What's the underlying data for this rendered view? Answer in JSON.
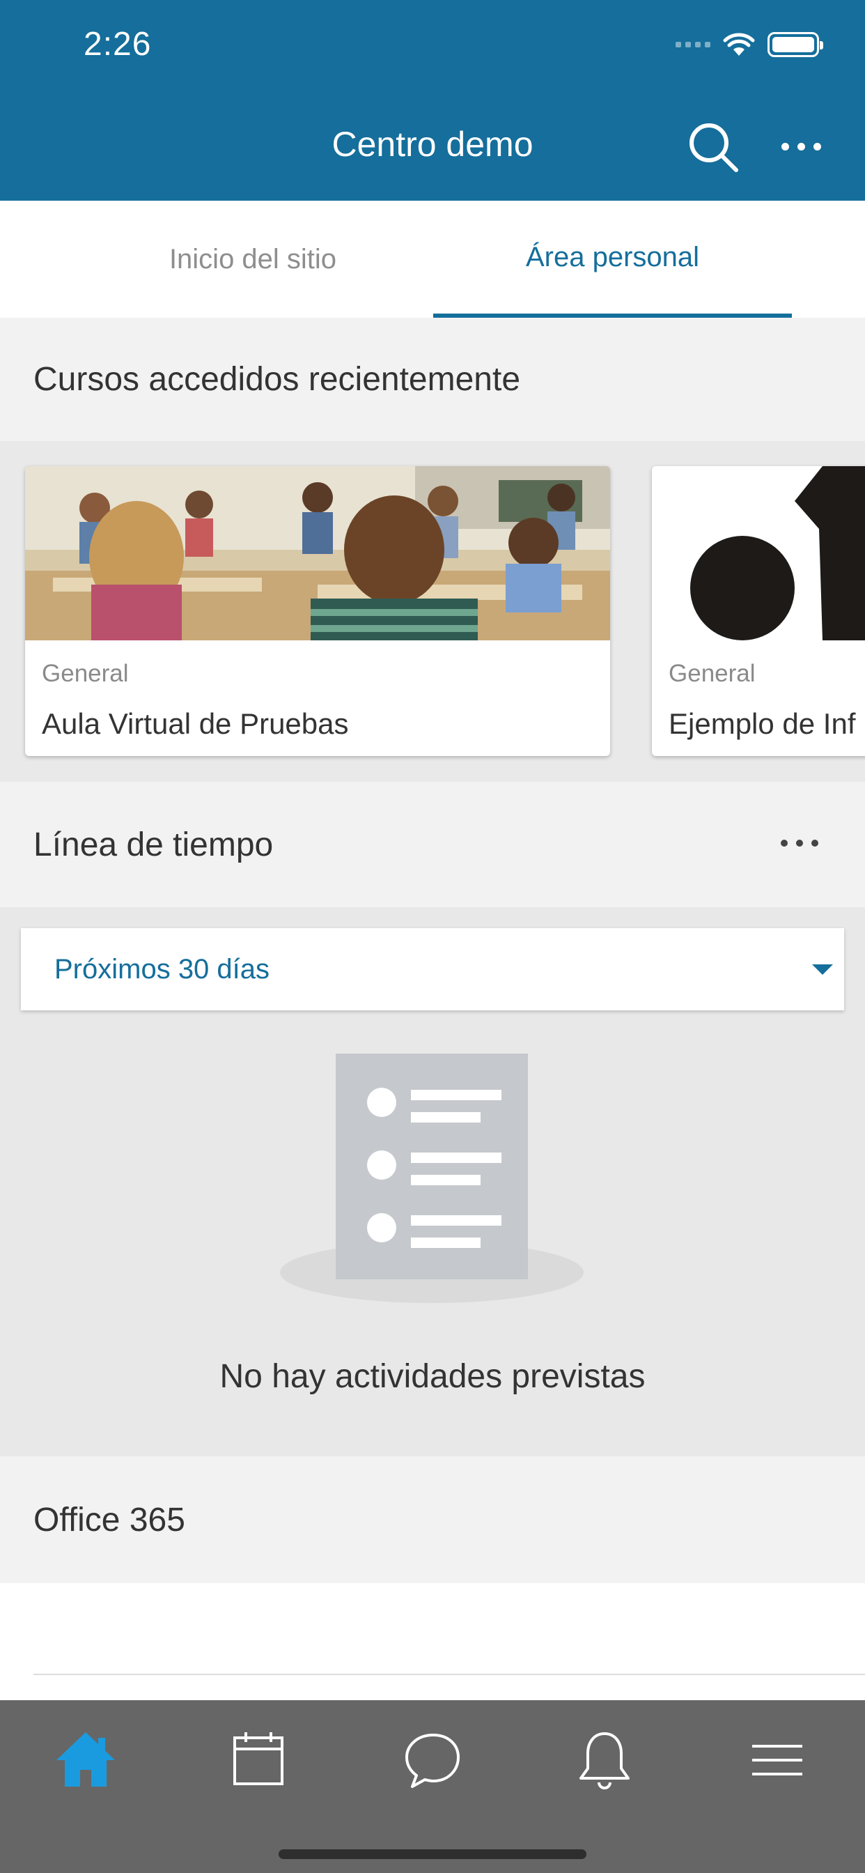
{
  "status_bar": {
    "time": "2:26"
  },
  "header": {
    "title": "Centro demo"
  },
  "tabs": [
    {
      "label": "Inicio del sitio",
      "active": false
    },
    {
      "label": "Área personal",
      "active": true
    }
  ],
  "recent_courses": {
    "title": "Cursos accedidos recientemente",
    "courses": [
      {
        "category": "General",
        "name": "Aula Virtual de Pruebas"
      },
      {
        "category": "General",
        "name": "Ejemplo de Inf"
      }
    ]
  },
  "timeline": {
    "title": "Línea de tiempo",
    "filter": "Próximos 30 días",
    "empty_text": "No hay actividades previstas"
  },
  "office": {
    "title": "Office 365"
  },
  "tabbar": {
    "items": [
      "home-icon",
      "calendar-icon",
      "messages-icon",
      "notifications-icon",
      "menu-icon"
    ],
    "active_color": "#1a9be0"
  },
  "colors": {
    "brand": "#156e9b",
    "tabbar": "#666666"
  }
}
